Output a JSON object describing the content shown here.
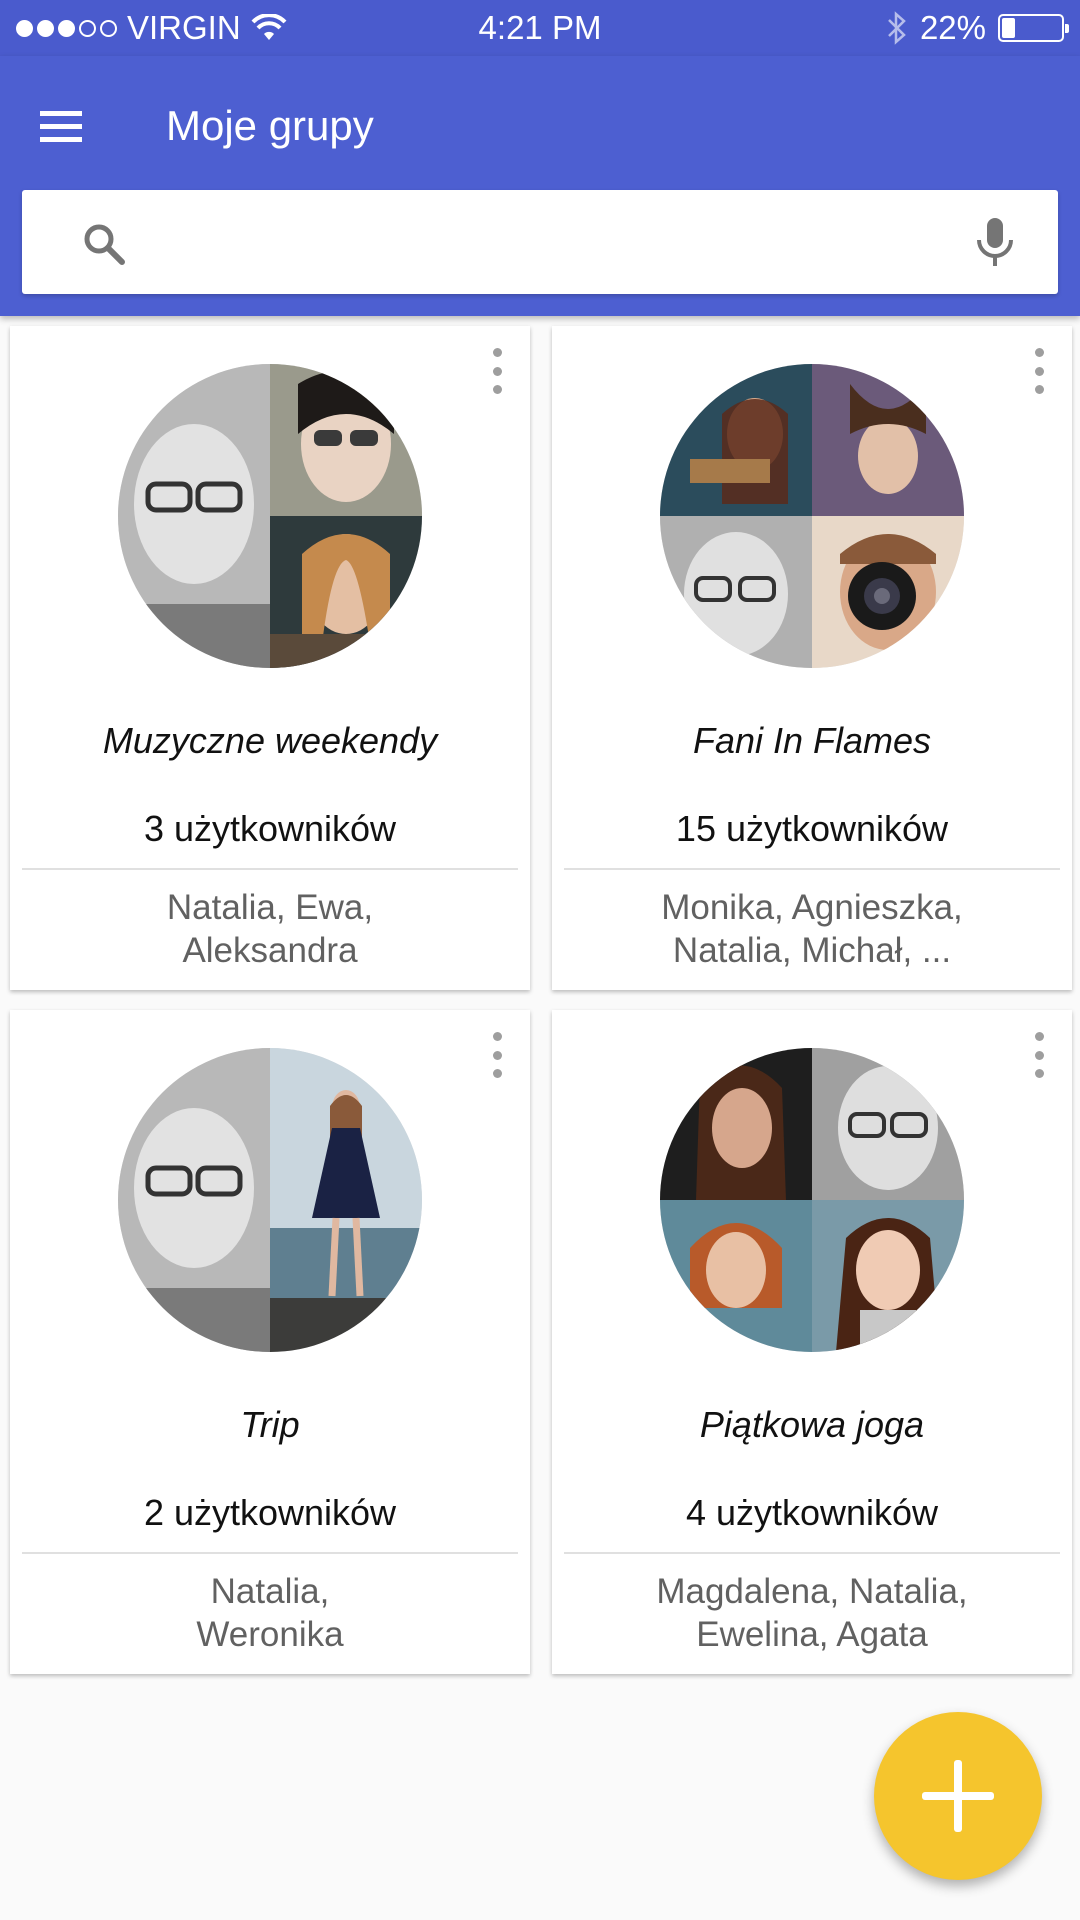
{
  "status_bar": {
    "carrier": "VIRGIN",
    "time": "4:21 PM",
    "battery": "22%",
    "battery_level": 0.22,
    "signal_bars_filled": 3,
    "signal_bars_total": 5
  },
  "app_bar": {
    "title": "Moje grupy",
    "menu_icon": "menu-icon",
    "background_color": "#4d5fd1"
  },
  "search": {
    "placeholder": "",
    "value": "",
    "search_icon": "search-icon",
    "mic_icon": "mic-icon"
  },
  "groups": [
    {
      "title": "Muzyczne weekendy",
      "count": "3 użytkowników",
      "members_line1": "Natalia, Ewa,",
      "members_line2": "Aleksandra"
    },
    {
      "title": "Fani In Flames",
      "count": "15 użytkowników",
      "members_line1": "Monika, Agnieszka,",
      "members_line2": "Natalia, Michał, ..."
    },
    {
      "title": "Trip",
      "count": "2 użytkowników",
      "members_line1": "Natalia,",
      "members_line2": "Weronika"
    },
    {
      "title": "Piątkowa joga",
      "count": "4 użytkowników",
      "members_line1": "Magdalena, Natalia,",
      "members_line2": "Ewelina, Agata"
    }
  ],
  "fab": {
    "icon": "plus-icon",
    "color": "#f5c52d"
  }
}
